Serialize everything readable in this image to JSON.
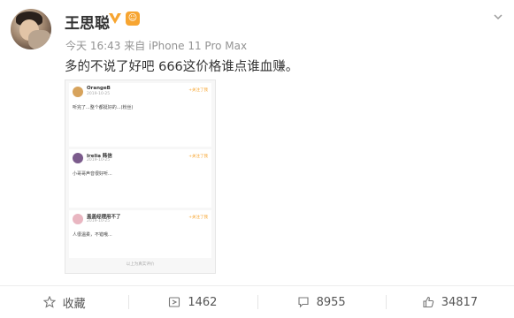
{
  "post": {
    "author": "王思聪",
    "meta": "今天 16:43 来自 iPhone 11 Pro Max",
    "text": "多的不说了好吧 666这价格谁点谁血赚。",
    "colors": {
      "accent": "#f7a531",
      "verified": "#f7a531"
    }
  },
  "screenshot": {
    "comments": [
      {
        "name": "OrangeB",
        "time": "2019-10-25",
        "follow": "+关注了我",
        "text": "听完了...整个都挺好的...(粉丝)"
      },
      {
        "name": "Irelia 韩信",
        "time": "2019-10-25",
        "follow": "+关注了我",
        "text": "小哥哥声音很好听..."
      },
      {
        "name": "盖盖经理用不了",
        "time": "2019-10-25",
        "follow": "+关注了我",
        "text": "人很温柔，不错哦..."
      }
    ],
    "footer": "以上为真实评价"
  },
  "toolbar": {
    "collect_label": "收藏",
    "repost_count": "1462",
    "comment_count": "8955",
    "like_count": "34817"
  }
}
